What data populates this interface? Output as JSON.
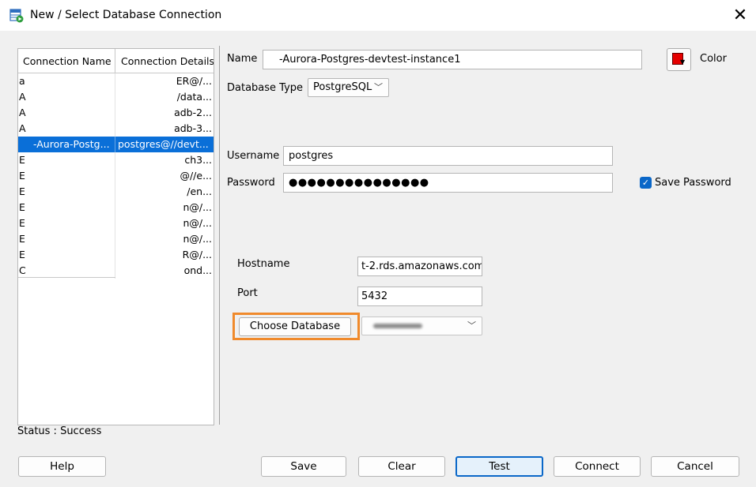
{
  "window": {
    "title": "New / Select Database Connection",
    "close_glyph": "✕"
  },
  "connections": {
    "headers": [
      "Connection Name",
      "Connection Details"
    ],
    "rows": [
      {
        "name": "a",
        "details": "ER@/..."
      },
      {
        "name": "A",
        "details": "/data..."
      },
      {
        "name": "A",
        "details": "adb-2..."
      },
      {
        "name": "A",
        "details": "adb-3..."
      },
      {
        "name": "-Aurora-Postg...",
        "details": "postgres@//devt..."
      },
      {
        "name": "E",
        "details": "ch3..."
      },
      {
        "name": "E",
        "details": "@//e..."
      },
      {
        "name": "E",
        "details": "/en..."
      },
      {
        "name": "E",
        "details": "n@/..."
      },
      {
        "name": "E",
        "details": "n@/..."
      },
      {
        "name": "E",
        "details": "n@/..."
      },
      {
        "name": "E",
        "details": "R@/..."
      },
      {
        "name": "C",
        "details": "ond..."
      }
    ],
    "selected_index": 4
  },
  "form": {
    "name_label": "Name",
    "name_value": "-Aurora-Postgres-devtest-instance1",
    "color_label": "Color",
    "db_type_label": "Database Type",
    "db_type_value": "PostgreSQL",
    "username_label": "Username",
    "username_value": "postgres",
    "password_label": "Password",
    "password_value": "●●●●●●●●●●●●●●●",
    "save_password_label": "Save Password",
    "save_password_checked": true,
    "hostname_label": "Hostname",
    "hostname_value": "t-2.rds.amazonaws.com",
    "port_label": "Port",
    "port_value": "5432",
    "choose_db_label": "Choose Database"
  },
  "status": "Status : Success",
  "buttons": {
    "help": "Help",
    "save": "Save",
    "clear": "Clear",
    "test": "Test",
    "connect": "Connect",
    "cancel": "Cancel"
  },
  "colors": {
    "selection": "#0a6fd8",
    "highlight": "#f08a2c",
    "color_swatch": "#e50000",
    "checkbox": "#0a67c8"
  },
  "icons": {
    "app": "database-connection-icon",
    "close": "close-icon",
    "combo": "chevron-down-icon",
    "checkbox": "checkmark-icon"
  }
}
